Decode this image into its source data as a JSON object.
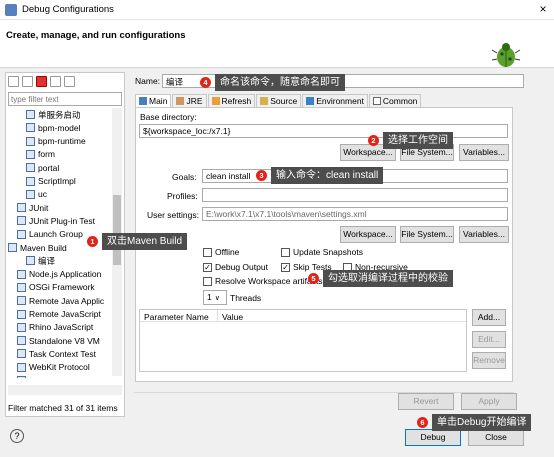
{
  "window": {
    "title": "Debug Configurations",
    "close": "×"
  },
  "banner": {
    "title": "Create, manage, and run configurations"
  },
  "left": {
    "filter_placeholder": "type filter text",
    "tree": [
      {
        "label": "单服务启动",
        "indent": 2
      },
      {
        "label": "bpm-model",
        "indent": 2
      },
      {
        "label": "bpm-runtime",
        "indent": 2
      },
      {
        "label": "form",
        "indent": 2
      },
      {
        "label": "portal",
        "indent": 2
      },
      {
        "label": "ScriptImpl",
        "indent": 2
      },
      {
        "label": "uc",
        "indent": 2
      },
      {
        "label": "JUnit",
        "indent": 1
      },
      {
        "label": "JUnit Plug-in Test",
        "indent": 1
      },
      {
        "label": "Launch Group",
        "indent": 1
      },
      {
        "label": "Maven Build",
        "indent": 0
      },
      {
        "label": "编译",
        "indent": 2
      },
      {
        "label": "Node.js Application",
        "indent": 1
      },
      {
        "label": "OSGi Framework",
        "indent": 1
      },
      {
        "label": "Remote Java Applic",
        "indent": 1
      },
      {
        "label": "Remote JavaScript",
        "indent": 1
      },
      {
        "label": "Rhino JavaScript",
        "indent": 1
      },
      {
        "label": "Standalone V8 VM",
        "indent": 1
      },
      {
        "label": "Task Context Test",
        "indent": 1
      },
      {
        "label": "WebKit Protocol",
        "indent": 1
      },
      {
        "label": "XSL",
        "indent": 1
      }
    ],
    "matched": "Filter matched 31 of 31 items"
  },
  "form": {
    "name_label": "Name:",
    "name_value": "编译",
    "tabs": [
      "Main",
      "JRE",
      "Refresh",
      "Source",
      "Environment",
      "Common"
    ],
    "base_dir_label": "Base directory:",
    "base_dir_value": "${workspace_loc:/x7.1}",
    "workspace_btn": "Workspace...",
    "filesystem_btn": "File System...",
    "variables_btn": "Variables...",
    "goals_label": "Goals:",
    "goals_value": "clean install",
    "profiles_label": "Profiles:",
    "user_settings_label": "User settings:",
    "user_settings_value": "E:\\work\\x7.1\\x7.1\\tools\\maven\\settings.xml",
    "offline": "Offline",
    "update_snapshots": "Update Snapshots",
    "debug_output": "Debug Output",
    "skip_tests": "Skip Tests",
    "non_recursive": "Non-recursive",
    "resolve_ws": "Resolve Workspace artifacts",
    "threads_value": "1",
    "threads_label": "Threads",
    "param_col": "Parameter Name",
    "value_col": "Value",
    "add_btn": "Add...",
    "edit_btn": "Edit...",
    "remove_btn": "Remove"
  },
  "footer": {
    "revert": "Revert",
    "apply": "Apply",
    "debug": "Debug",
    "close": "Close",
    "help": "?"
  },
  "annotations": [
    {
      "num": "4",
      "text": "命名该命令，随意命名即可"
    },
    {
      "num": "2",
      "text": "选择工作空间"
    },
    {
      "num": "3",
      "text": "输入命令：clean install"
    },
    {
      "num": "1",
      "text": "双击Maven Build"
    },
    {
      "num": "5",
      "text": "勾选取消编译过程中的校验"
    },
    {
      "num": "6",
      "text": "单击Debug开始编译"
    }
  ]
}
